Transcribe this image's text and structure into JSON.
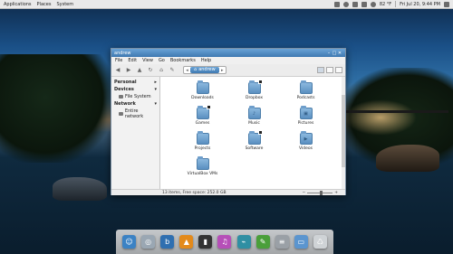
{
  "top_panel": {
    "menus": [
      "Applications",
      "Places",
      "System"
    ],
    "temperature": "82 °F",
    "clock": "Fri Jul 20,  9:44 PM"
  },
  "window": {
    "title": "andrew",
    "menu": [
      "File",
      "Edit",
      "View",
      "Go",
      "Bookmarks",
      "Help"
    ],
    "path_crumb": "andrew"
  },
  "sidebar": {
    "sections": [
      {
        "label": "Personal",
        "items": []
      },
      {
        "label": "Devices",
        "items": [
          "File System"
        ]
      },
      {
        "label": "Network",
        "items": [
          "Entire network"
        ]
      }
    ]
  },
  "files": [
    {
      "name": "Downloads",
      "glyph": "",
      "linked": false
    },
    {
      "name": "Dropbox",
      "glyph": "",
      "linked": true
    },
    {
      "name": "Podcasts",
      "glyph": "",
      "linked": false
    },
    {
      "name": "Games",
      "glyph": "",
      "linked": true
    },
    {
      "name": "Music",
      "glyph": "♪",
      "linked": false
    },
    {
      "name": "Pictures",
      "glyph": "▣",
      "linked": false
    },
    {
      "name": "Projects",
      "glyph": "",
      "linked": false
    },
    {
      "name": "Software",
      "glyph": "",
      "linked": true
    },
    {
      "name": "Videos",
      "glyph": "▶",
      "linked": false
    },
    {
      "name": "VirtualBox VMs",
      "glyph": "",
      "linked": false
    }
  ],
  "status": "13 items, Free space: 252.0 GB",
  "zoom_level": 0.55,
  "dock_apps": [
    {
      "name": "finder-app",
      "color": "#3b82c4",
      "glyph": "☺"
    },
    {
      "name": "web-browser-app",
      "color": "#9aa7b3",
      "glyph": "◎"
    },
    {
      "name": "vuze-app",
      "color": "#2f6fb0",
      "glyph": "b"
    },
    {
      "name": "vlc-app",
      "color": "#e38a1b",
      "glyph": "▲"
    },
    {
      "name": "terminal-app",
      "color": "#333333",
      "glyph": "▮"
    },
    {
      "name": "media-player-app",
      "color": "#b64fb8",
      "glyph": "♫"
    },
    {
      "name": "system-monitor-app",
      "color": "#2f8fa3",
      "glyph": "⌁"
    },
    {
      "name": "settings-app",
      "color": "#4a9f3a",
      "glyph": "✎"
    },
    {
      "name": "text-editor-app",
      "color": "#9aa0a6",
      "glyph": "≡"
    },
    {
      "name": "home-folder-app",
      "color": "#5b95cf",
      "glyph": "▭"
    },
    {
      "name": "trash-app",
      "color": "#cfd3d6",
      "glyph": "♺"
    }
  ]
}
